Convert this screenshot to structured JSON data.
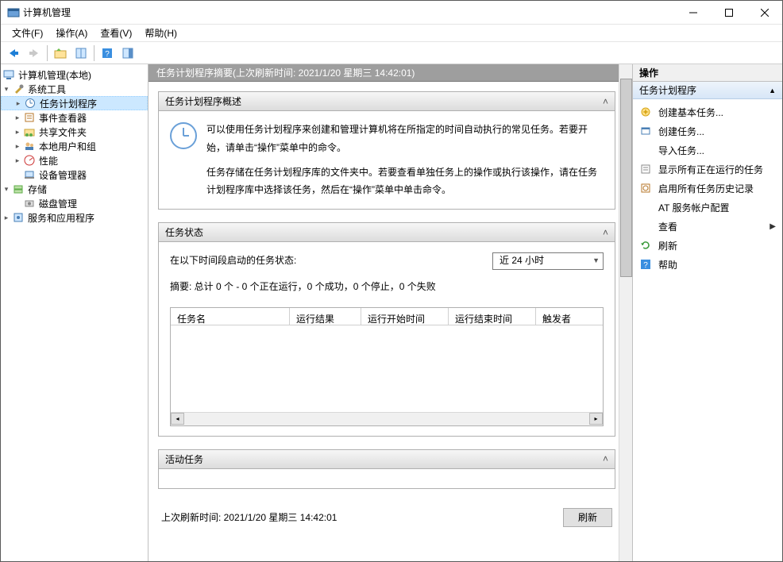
{
  "titlebar": {
    "title": "计算机管理"
  },
  "menubar": [
    "文件(F)",
    "操作(A)",
    "查看(V)",
    "帮助(H)"
  ],
  "tree": {
    "root_label": "计算机管理(本地)",
    "system_tools": {
      "label": "系统工具",
      "children": [
        {
          "label": "任务计划程序",
          "selected": true
        },
        {
          "label": "事件查看器"
        },
        {
          "label": "共享文件夹"
        },
        {
          "label": "本地用户和组"
        },
        {
          "label": "性能"
        },
        {
          "label": "设备管理器"
        }
      ]
    },
    "storage": {
      "label": "存储",
      "children": [
        {
          "label": "磁盘管理"
        }
      ]
    },
    "services": {
      "label": "服务和应用程序"
    }
  },
  "center": {
    "summary_title": "任务计划程序摘要(上次刷新时间: 2021/1/20 星期三 14:42:01)",
    "overview": {
      "head": "任务计划程序概述",
      "p1": "可以使用任务计划程序来创建和管理计算机将在所指定的时间自动执行的常见任务。若要开始，请单击“操作”菜单中的命令。",
      "p2": "任务存储在任务计划程序库的文件夹中。若要查看单独任务上的操作或执行该操作，请在任务计划程序库中选择该任务，然后在“操作”菜单中单击命令。"
    },
    "status": {
      "head": "任务状态",
      "label": "在以下时间段启动的任务状态:",
      "combo": "近 24 小时",
      "summary": "摘要: 总计 0 个 - 0 个正在运行，0 个成功，0 个停止，0 个失败",
      "cols": [
        "任务名",
        "运行结果",
        "运行开始时间",
        "运行结束时间",
        "触发者"
      ]
    },
    "active": {
      "head": "活动任务"
    },
    "footer": {
      "last_refresh": "上次刷新时间: 2021/1/20 星期三 14:42:01",
      "refresh_btn": "刷新"
    }
  },
  "actions": {
    "pane_title": "操作",
    "group": "任务计划程序",
    "items": [
      {
        "k": "create-basic",
        "label": "创建基本任务...",
        "icon": "sparkle"
      },
      {
        "k": "create",
        "label": "创建任务...",
        "icon": "window"
      },
      {
        "k": "import",
        "label": "导入任务...",
        "icon": "none"
      },
      {
        "k": "show-running",
        "label": "显示所有正在运行的任务",
        "icon": "list"
      },
      {
        "k": "enable-history",
        "label": "启用所有任务历史记录",
        "icon": "history"
      },
      {
        "k": "at-service",
        "label": "AT 服务帐户配置",
        "icon": "none"
      },
      {
        "k": "view",
        "label": "查看",
        "icon": "none",
        "submenu": true
      },
      {
        "k": "refresh",
        "label": "刷新",
        "icon": "refresh"
      },
      {
        "k": "help",
        "label": "帮助",
        "icon": "help"
      }
    ]
  }
}
